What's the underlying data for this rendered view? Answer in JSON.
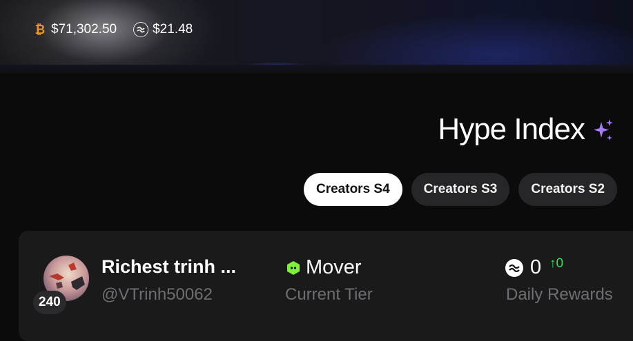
{
  "ticker": {
    "items": [
      {
        "icon": "bitcoin-icon",
        "value": "$71,302.50"
      },
      {
        "icon": "sui-icon",
        "value": "$21.48"
      }
    ]
  },
  "header": {
    "title": "Hype Index",
    "title_icon": "sparkle-icon"
  },
  "tabs": [
    {
      "label": "Creators S4",
      "active": true
    },
    {
      "label": "Creators S3",
      "active": false
    },
    {
      "label": "Creators S2",
      "active": false
    }
  ],
  "leaderboard": {
    "rows": [
      {
        "rank": "240",
        "name": "Richest trinh ...",
        "handle": "@VTrinh50062",
        "tier": "Mover",
        "tier_caption": "Current Tier",
        "rewards_value": "0",
        "rewards_delta": "0",
        "rewards_caption": "Daily Rewards"
      }
    ]
  },
  "colors": {
    "background": "#0b0b0c",
    "card": "#1a1a1b",
    "tier_accent": "#7ef03a",
    "delta_up": "#3ddc5a",
    "sparkle": "#a57bf7",
    "bitcoin": "#f7931a"
  }
}
